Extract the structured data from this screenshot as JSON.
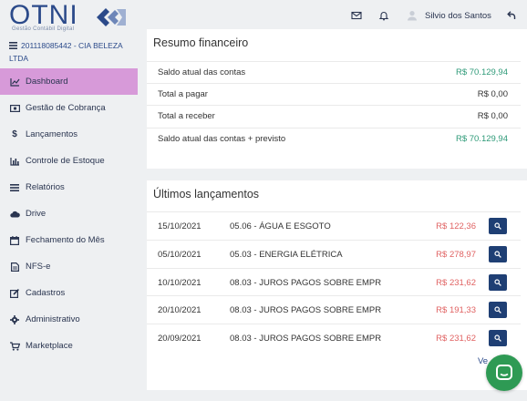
{
  "logo": {
    "name": "OTNI",
    "subtitle": "Gestão Contábil Digital"
  },
  "company": {
    "label": "201118085442 - CIA BELEZA LTDA"
  },
  "sidebar": {
    "items": [
      {
        "label": "Dashboard",
        "icon": "chart-line-icon",
        "active": true
      },
      {
        "label": "Gestão de Cobrança",
        "icon": "money-bill-icon"
      },
      {
        "label": "Lançamentos",
        "icon": "dollar-icon"
      },
      {
        "label": "Controle de Estoque",
        "icon": "bar-chart-icon"
      },
      {
        "label": "Relatórios",
        "icon": "list-icon"
      },
      {
        "label": "Drive",
        "icon": "cloud-icon"
      },
      {
        "label": "Fechamento do Mês",
        "icon": "calendar-icon"
      },
      {
        "label": "NFS-e",
        "icon": "file-icon"
      },
      {
        "label": "Cadastros",
        "icon": "edit-icon"
      },
      {
        "label": "Administrativo",
        "icon": "gear-icon"
      },
      {
        "label": "Marketplace",
        "icon": "cart-icon"
      }
    ]
  },
  "topbar": {
    "user_name": "Silvio dos Santos"
  },
  "resumo": {
    "title": "Resumo financeiro",
    "rows": [
      {
        "label": "Saldo atual das contas",
        "value": "R$ 70.129,94",
        "positive": true
      },
      {
        "label": "Total a pagar",
        "value": "R$ 0,00",
        "positive": false
      },
      {
        "label": "Total a receber",
        "value": "R$ 0,00",
        "positive": false
      },
      {
        "label": "Saldo atual das contas + previsto",
        "value": "R$ 70.129,94",
        "positive": true
      }
    ]
  },
  "lancamentos": {
    "title": "Últimos lançamentos",
    "rows": [
      {
        "date": "15/10/2021",
        "desc": "05.06 - ÁGUA E ESGOTO",
        "amount": "R$ 122,36"
      },
      {
        "date": "05/10/2021",
        "desc": "05.03 - ENERGIA ELÉTRICA",
        "amount": "R$ 278,97"
      },
      {
        "date": "10/10/2021",
        "desc": "08.03 - JUROS PAGOS SOBRE EMPR",
        "amount": "R$ 231,62"
      },
      {
        "date": "20/10/2021",
        "desc": "08.03 - JUROS PAGOS SOBRE EMPR",
        "amount": "R$ 191,33"
      },
      {
        "date": "20/09/2021",
        "desc": "08.03 - JUROS PAGOS SOBRE EMPR",
        "amount": "R$ 231,62"
      }
    ],
    "more_link": "Ve"
  },
  "colors": {
    "brand": "#2b4a8a",
    "active_menu": "#d79ad9",
    "positive": "#2e9a78",
    "negative": "#e06262",
    "button": "#1f3f74",
    "chat": "#2e9a54"
  }
}
